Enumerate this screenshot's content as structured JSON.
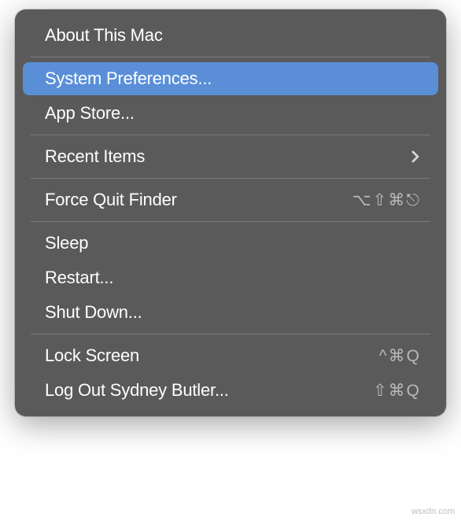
{
  "menu": {
    "items": [
      {
        "label": "About This Mac",
        "has_submenu": false,
        "shortcut": "",
        "selected": false
      },
      {
        "label": "System Preferences...",
        "has_submenu": false,
        "shortcut": "",
        "selected": true
      },
      {
        "label": "App Store...",
        "has_submenu": false,
        "shortcut": "",
        "selected": false
      },
      {
        "label": "Recent Items",
        "has_submenu": true,
        "shortcut": "",
        "selected": false
      },
      {
        "label": "Force Quit Finder",
        "has_submenu": false,
        "shortcut": "⌥⇧⌘⎋",
        "selected": false
      },
      {
        "label": "Sleep",
        "has_submenu": false,
        "shortcut": "",
        "selected": false
      },
      {
        "label": "Restart...",
        "has_submenu": false,
        "shortcut": "",
        "selected": false
      },
      {
        "label": "Shut Down...",
        "has_submenu": false,
        "shortcut": "",
        "selected": false
      },
      {
        "label": "Lock Screen",
        "has_submenu": false,
        "shortcut": "^⌘Q",
        "selected": false
      },
      {
        "label": "Log Out Sydney Butler...",
        "has_submenu": false,
        "shortcut": "⇧⌘Q",
        "selected": false
      }
    ]
  },
  "watermark": "wsxdn.com"
}
